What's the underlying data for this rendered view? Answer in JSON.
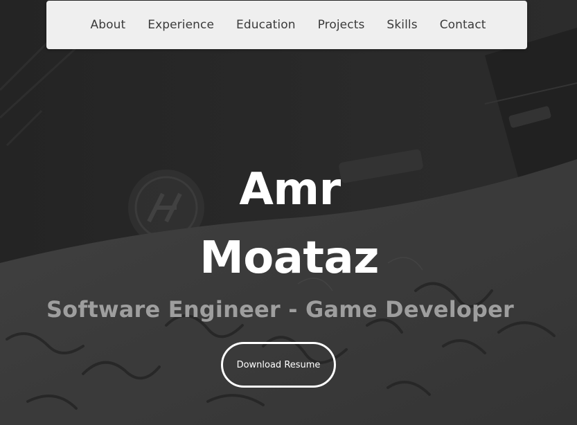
{
  "nav": {
    "items": [
      {
        "label": "About"
      },
      {
        "label": "Experience"
      },
      {
        "label": "Education"
      },
      {
        "label": "Projects"
      },
      {
        "label": "Skills"
      },
      {
        "label": "Contact"
      }
    ]
  },
  "hero": {
    "first_name": "Amr",
    "last_name": "Moataz",
    "tagline": "Software Engineer - Game Developer",
    "resume_button_label": "Download Resume"
  },
  "colors": {
    "background": "#2e2e2e",
    "navbar": "#efefef",
    "nav_text": "#3a3a3a",
    "name_text": "#ffffff",
    "tagline_text": "#9e9e9e",
    "button_border": "#ffffff"
  },
  "background_image": {
    "description_icon": "hp-laptop-calligraphy-photo"
  }
}
